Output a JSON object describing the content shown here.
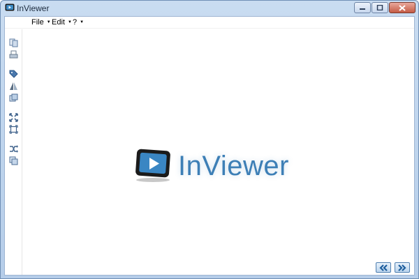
{
  "window": {
    "title": "InViewer"
  },
  "menu": [
    {
      "label": "File"
    },
    {
      "label": "Edit"
    },
    {
      "label": "?"
    }
  ],
  "toolbar": {
    "tools": [
      {
        "icon": "copy-pages-icon"
      },
      {
        "icon": "print-icon"
      },
      {
        "icon": "tag-icon"
      },
      {
        "icon": "flip-icon"
      },
      {
        "icon": "layers-icon"
      },
      {
        "icon": "fit-to-window-icon"
      },
      {
        "icon": "actual-size-icon"
      },
      {
        "icon": "shuffle-icon"
      },
      {
        "icon": "duplicate-icon"
      }
    ]
  },
  "logo": {
    "text": "InViewer",
    "color": "#3d7fb6"
  },
  "navigation": {
    "previous_icon": "double-chevron-left-icon",
    "next_icon": "double-chevron-right-icon"
  }
}
